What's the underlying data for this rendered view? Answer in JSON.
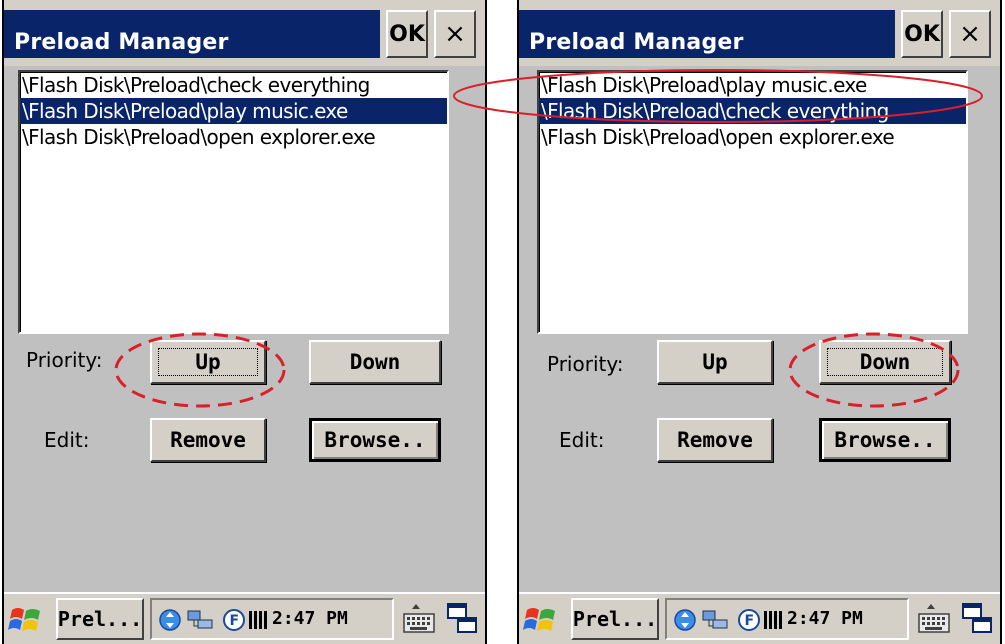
{
  "left": {
    "title": "Preload Manager",
    "ok_label": "OK",
    "close_label": "×",
    "items": [
      {
        "text": "\\Flash Disk\\Preload\\check everything",
        "selected": false
      },
      {
        "text": "\\Flash Disk\\Preload\\play music.exe",
        "selected": true
      },
      {
        "text": "\\Flash Disk\\Preload\\open explorer.exe",
        "selected": false
      }
    ],
    "priority_label": "Priority:",
    "edit_label": "Edit:",
    "up_label": "Up",
    "down_label": "Down",
    "remove_label": "Remove",
    "browse_label": "Browse..",
    "task_label": "Prel...",
    "clock": "2:47 PM"
  },
  "right": {
    "title": "Preload Manager",
    "ok_label": "OK",
    "close_label": "×",
    "items": [
      {
        "text": "\\Flash Disk\\Preload\\play music.exe",
        "selected": false
      },
      {
        "text": "\\Flash Disk\\Preload\\check everything",
        "selected": true
      },
      {
        "text": "\\Flash Disk\\Preload\\open explorer.exe",
        "selected": false
      }
    ],
    "priority_label": "Priority:",
    "edit_label": "Edit:",
    "up_label": "Up",
    "down_label": "Down",
    "remove_label": "Remove",
    "browse_label": "Browse..",
    "task_label": "Prel...",
    "clock": "2:47 PM"
  },
  "colors": {
    "selection": "#0a246a",
    "annotation": "#d9202a",
    "face": "#d4d0c8"
  },
  "icons": [
    "windows-start-icon",
    "sync-icon",
    "network-icon",
    "f-key-icon",
    "battery-icon",
    "keyboard-icon",
    "desktop-icon"
  ]
}
